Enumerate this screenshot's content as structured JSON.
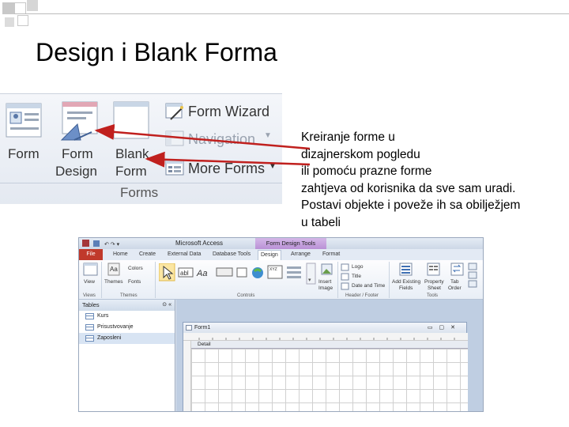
{
  "slide": {
    "title": "Design i Blank Forma",
    "description_lines": [
      "Kreiranje forme u",
      "dizajnerskom pogledu",
      "ili pomoću prazne forme",
      "zahtjeva od korisnika da sve sam uradi.",
      "Postavi objekte i poveže ih sa obilježjem",
      "u tabeli"
    ]
  },
  "ribbon_crop": {
    "buttons": {
      "form": "Form",
      "form_design_1": "Form",
      "form_design_2": "Design",
      "blank_form_1": "Blank",
      "blank_form_2": "Form"
    },
    "menu": {
      "form_wizard": "Form Wizard",
      "navigation": "Navigation",
      "more_forms": "More Forms"
    },
    "group_label": "Forms"
  },
  "access_window": {
    "app_title": "Microsoft Access",
    "context_tab_header": "Form Design Tools",
    "tabs": [
      "File",
      "Home",
      "Create",
      "External Data",
      "Database Tools",
      "Design",
      "Arrange",
      "Format"
    ],
    "active_tab": "Design",
    "ribbon": {
      "view": "View",
      "themes": "Themes",
      "colors": "Colors",
      "fonts": "Fonts",
      "insert_image_1": "Insert",
      "insert_image_2": "Image",
      "logo": "Logo",
      "title": "Title",
      "date_time": "Date and Time",
      "add_existing_1": "Add Existing",
      "add_existing_2": "Fields",
      "property_1": "Property",
      "property_2": "Sheet",
      "tab_order_1": "Tab",
      "tab_order_2": "Order",
      "groups": [
        "Views",
        "Themes",
        "Controls",
        "Header / Footer",
        "Tools"
      ]
    },
    "nav_pane": {
      "header": "Tables",
      "items": [
        "Kurs",
        "Prisustvovanje",
        "Zaposleni"
      ],
      "selected": "Zaposleni"
    },
    "form_window": {
      "title": "Form1",
      "section": "Detail"
    }
  },
  "colors": {
    "file_tab": "#c0392b",
    "arrow": "#c0201e",
    "context_tab": "#b991d6"
  }
}
